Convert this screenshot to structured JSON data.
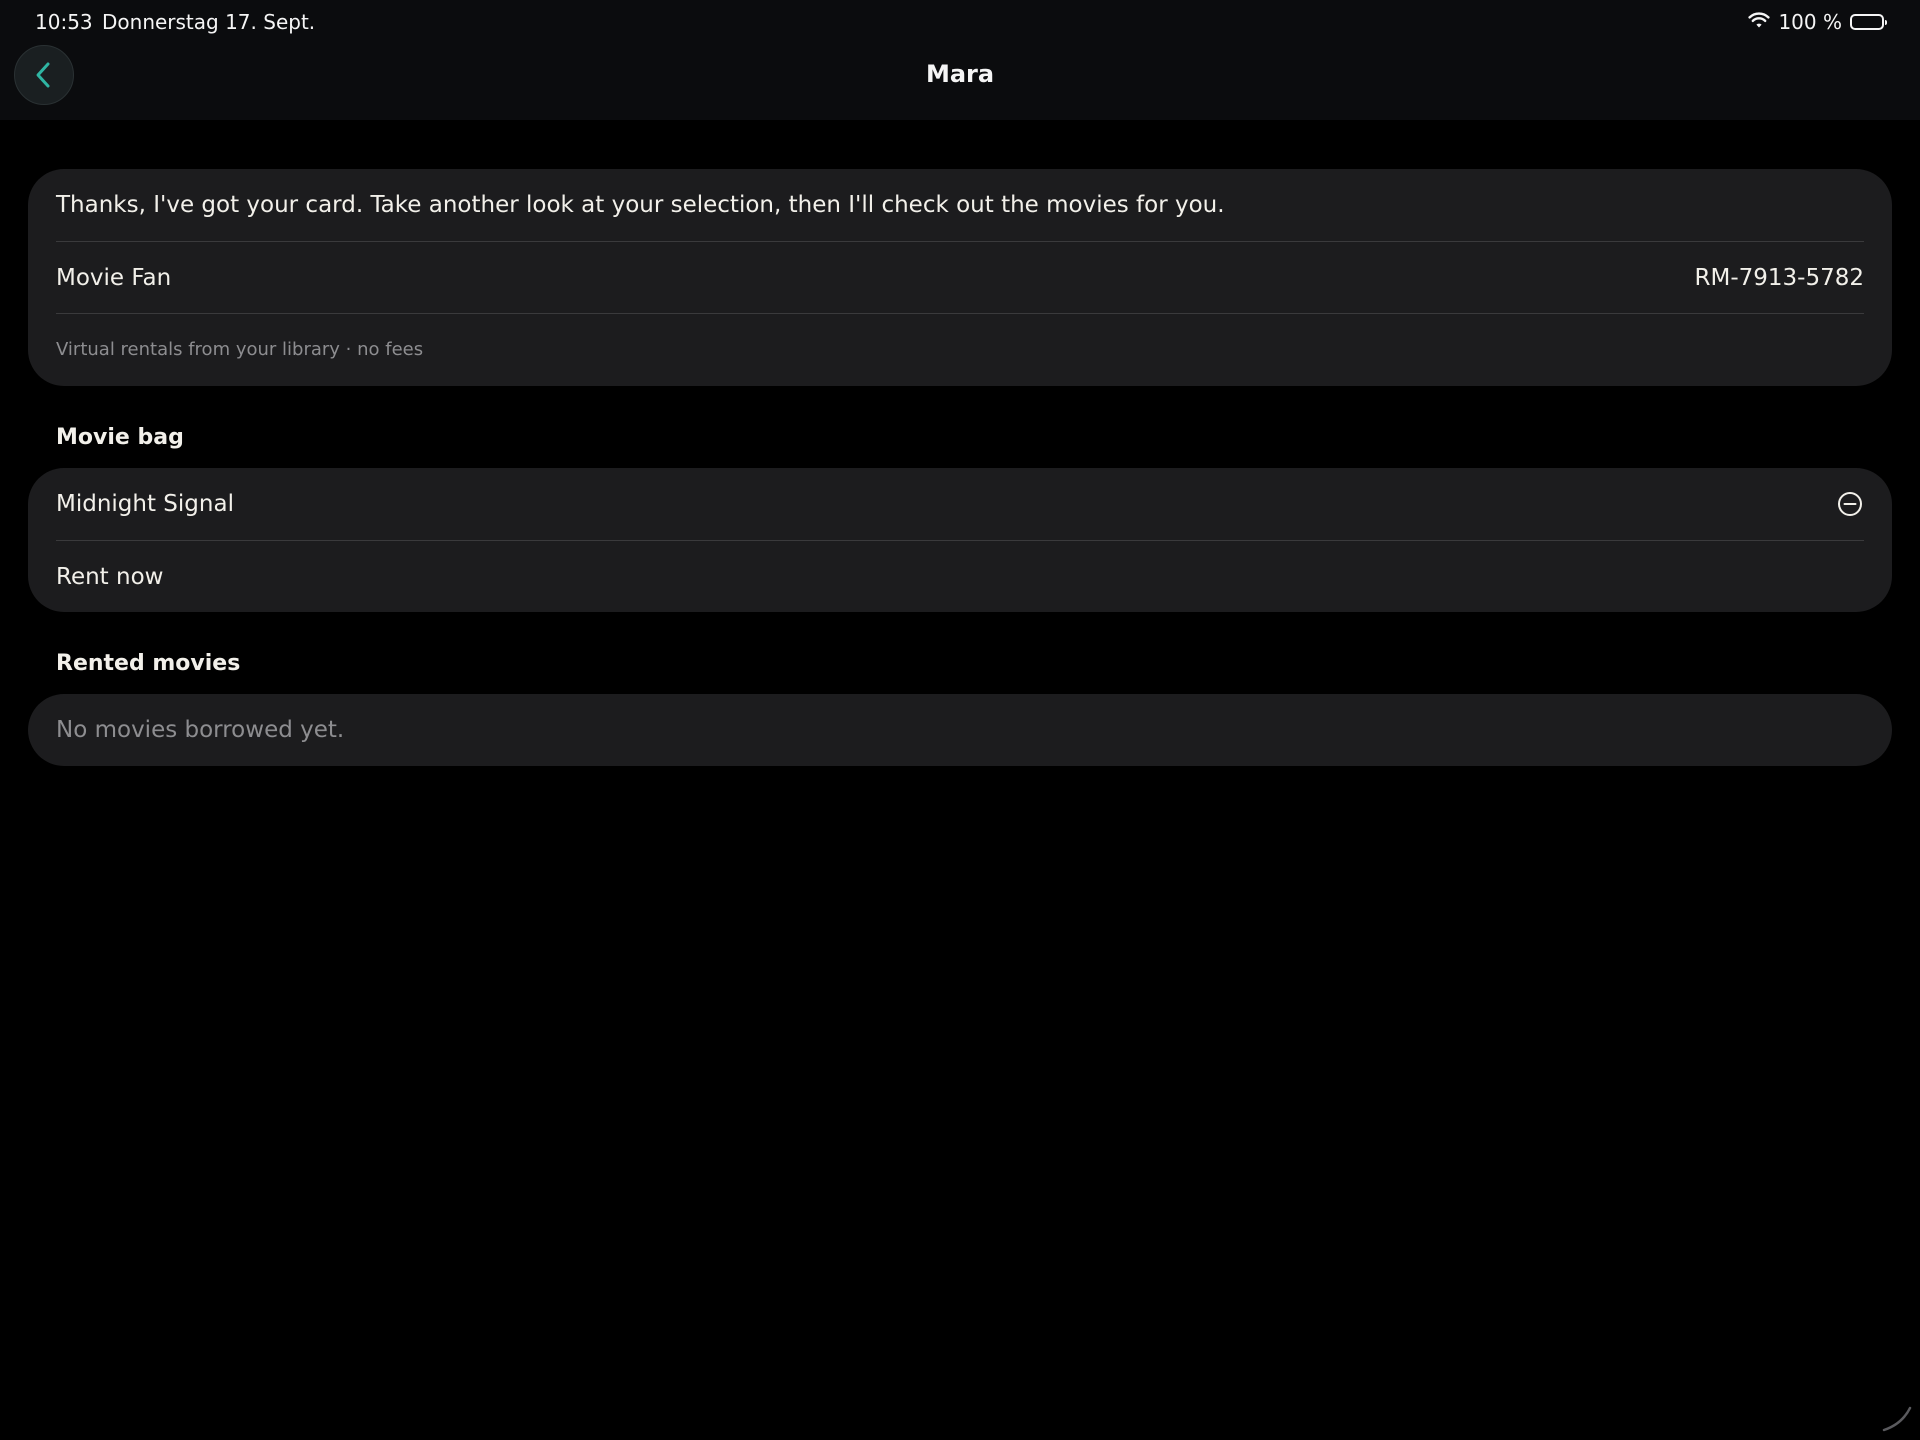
{
  "status_bar": {
    "time": "10:53",
    "date": "Donnerstag 17. Sept.",
    "battery_percent": "100 %",
    "battery_level": 1.0,
    "icons": [
      "wifi-icon",
      "battery-icon"
    ]
  },
  "nav": {
    "title": "Mara",
    "back_icon": "chevron-left-icon"
  },
  "info_card": {
    "message": "Thanks, I've got your card. Take another look at your selection, then I'll check out the movies for you.",
    "card_type": "Movie Fan",
    "card_number": "RM-7913-5782",
    "note": "Virtual rentals from your library · no fees"
  },
  "movie_bag": {
    "heading": "Movie bag",
    "items": [
      {
        "title": "Midnight Signal",
        "action_icon": "minus-circle-icon"
      }
    ],
    "rent_label": "Rent now"
  },
  "rented": {
    "heading": "Rented movies",
    "empty_text": "No movies borrowed yet."
  },
  "colors": {
    "background": "#000000",
    "card": "#1c1c1e",
    "accent": "#2fb5a3",
    "text": "#f2f0ea",
    "muted": "#8d8d90"
  }
}
